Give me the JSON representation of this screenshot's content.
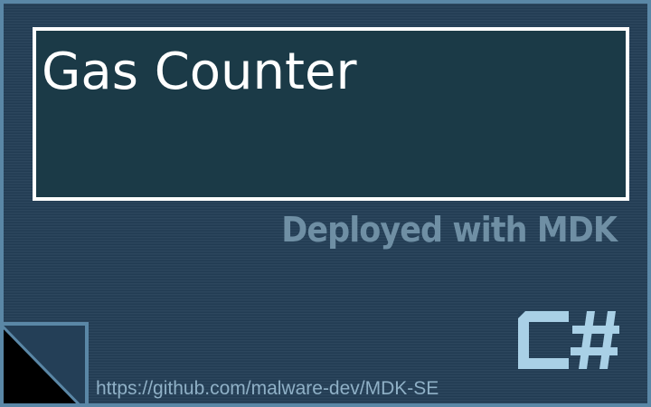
{
  "panel": {
    "title": "Gas Counter"
  },
  "banner": {
    "deployed_text": "Deployed with MDK"
  },
  "footer": {
    "url_text": "https://github.com/malware-dev/MDK-SE"
  },
  "icons": {
    "corner": "folded-corner-icon",
    "language": "csharp-logo-icon"
  },
  "colors": {
    "frame_border": "#5a87a6",
    "background": "#243f57",
    "title_box": "#1b3a47",
    "title_border": "#ffffff",
    "deployed_text": "#6f8fa4",
    "url_text": "#8fb0c6",
    "logo": "#a9d0e6"
  }
}
